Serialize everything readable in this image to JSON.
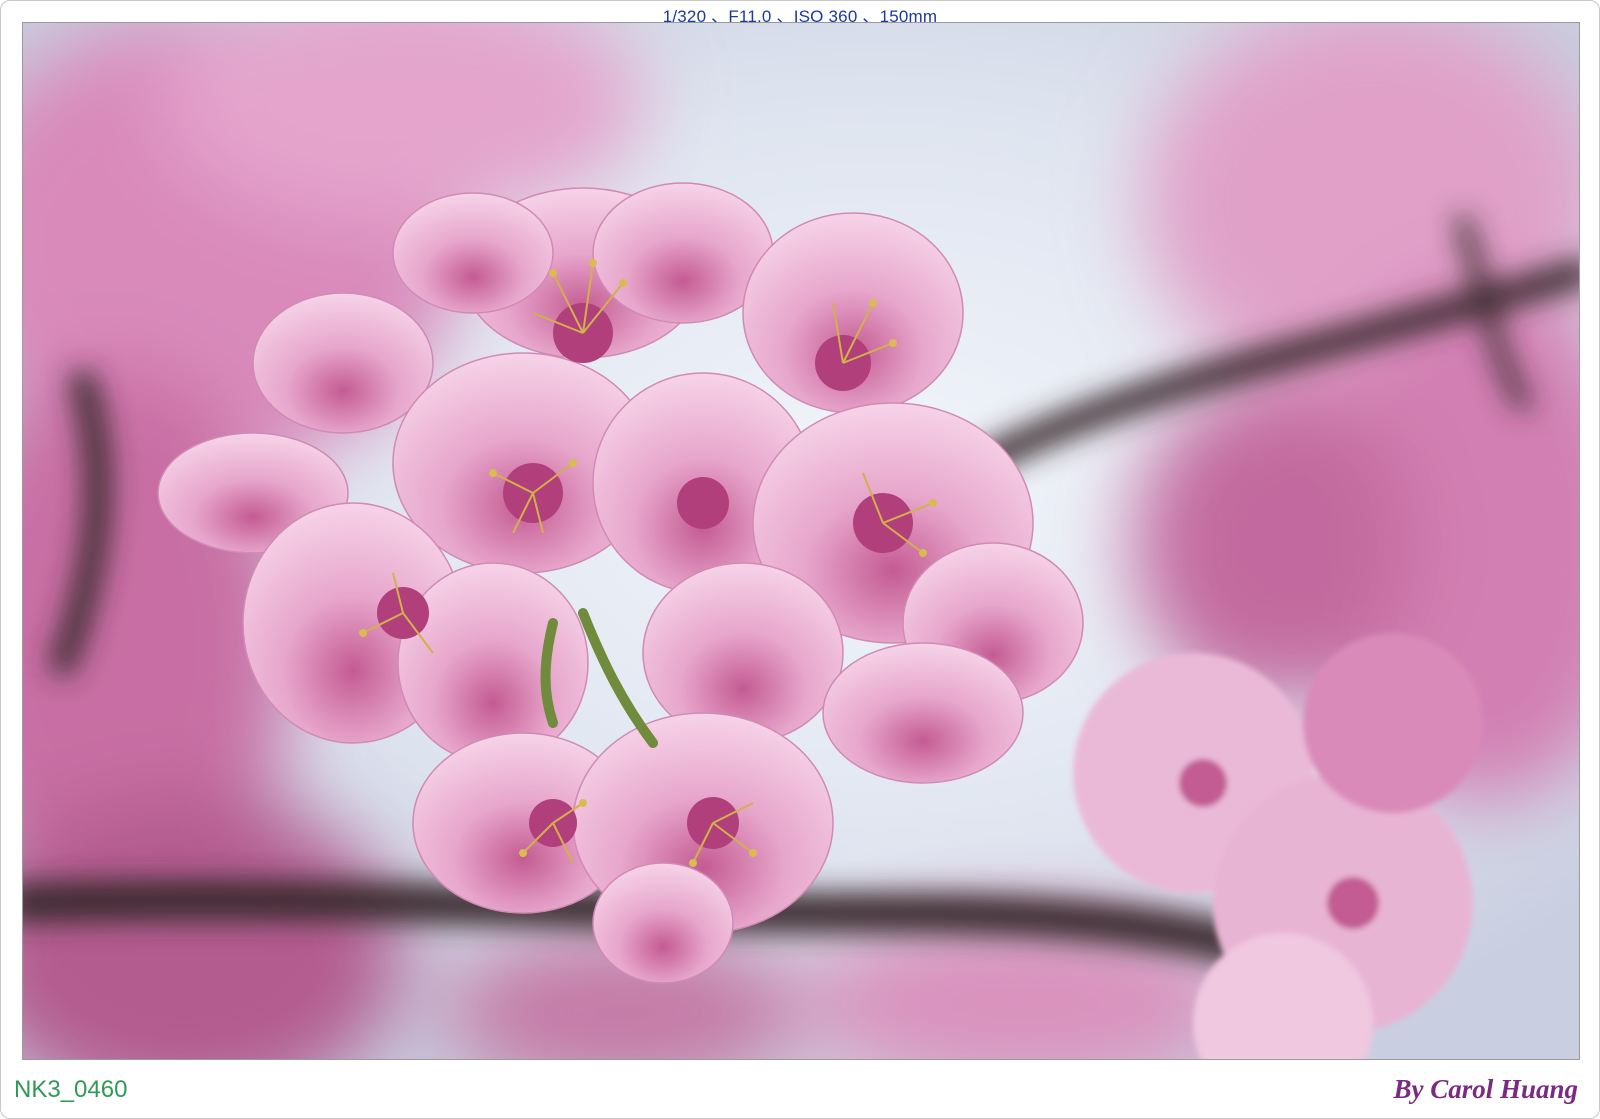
{
  "exif_caption": "1/320 、F11.0 、ISO 360 、150mm",
  "filename": "NK3_0460",
  "credit": "By Carol Huang",
  "colors": {
    "exif_text": "#1a3aa0",
    "filename_text": "#2e9a56",
    "credit_text": "#7a2a80",
    "blossom_pink": "#e7a8cf",
    "blossom_deep": "#c9578f",
    "sky": "#e8eef6",
    "branch": "#3a2a2e"
  }
}
